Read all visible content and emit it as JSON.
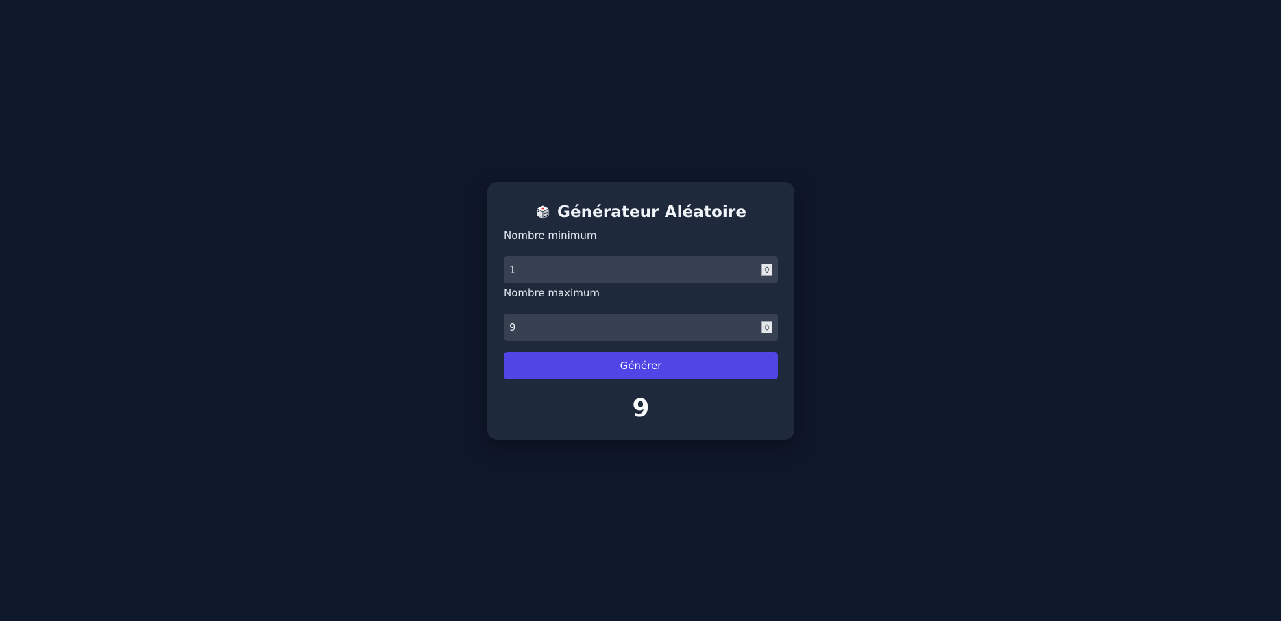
{
  "app": {
    "title": "Générateur Aléatoire",
    "icon": "dice-icon"
  },
  "form": {
    "min_label": "Nombre minimum",
    "min_value": "1",
    "max_label": "Nombre maximum",
    "max_value": "9",
    "generate_label": "Générer"
  },
  "result": {
    "value": "9"
  },
  "colors": {
    "background": "#0f172a",
    "card": "#1e293b",
    "input": "#374151",
    "accent": "#4f46e5",
    "text": "#f1f5f9"
  }
}
